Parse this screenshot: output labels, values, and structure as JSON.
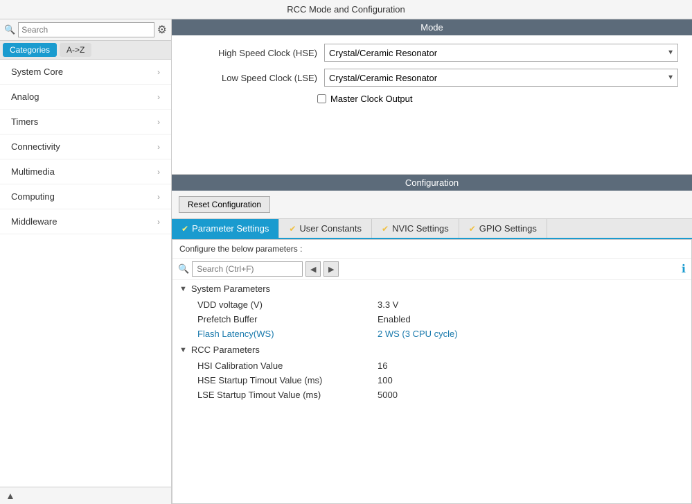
{
  "topbar": {
    "title": "RCC Mode and Configuration"
  },
  "sidebar": {
    "search_placeholder": "Search",
    "tabs": [
      {
        "label": "Categories",
        "active": true
      },
      {
        "label": "A->Z",
        "active": false
      }
    ],
    "nav_items": [
      {
        "label": "System Core"
      },
      {
        "label": "Analog"
      },
      {
        "label": "Timers"
      },
      {
        "label": "Connectivity"
      },
      {
        "label": "Multimedia"
      },
      {
        "label": "Computing"
      },
      {
        "label": "Middleware"
      }
    ],
    "bottom_icon": "▲"
  },
  "mode": {
    "header": "Mode",
    "fields": [
      {
        "label": "High Speed Clock (HSE)",
        "value": "Crystal/Ceramic Resonator"
      },
      {
        "label": "Low Speed Clock (LSE)",
        "value": "Crystal/Ceramic Resonator"
      }
    ],
    "master_clock_label": "Master Clock Output",
    "master_clock_checked": false
  },
  "config": {
    "header": "Configuration",
    "reset_button": "Reset Configuration",
    "tabs": [
      {
        "label": "Parameter Settings",
        "active": true
      },
      {
        "label": "User Constants",
        "active": false
      },
      {
        "label": "NVIC Settings",
        "active": false
      },
      {
        "label": "GPIO Settings",
        "active": false
      }
    ],
    "description": "Configure the below parameters :",
    "search_placeholder": "Search (Ctrl+F)",
    "param_groups": [
      {
        "name": "System Parameters",
        "params": [
          {
            "name": "VDD voltage (V)",
            "value": "3.3 V",
            "disabled": false
          },
          {
            "name": "Prefetch Buffer",
            "value": "Enabled",
            "disabled": false
          },
          {
            "name": "Flash Latency(WS)",
            "value": "2 WS (3 CPU cycle)",
            "disabled": true
          }
        ]
      },
      {
        "name": "RCC Parameters",
        "params": [
          {
            "name": "HSI Calibration Value",
            "value": "16",
            "disabled": false
          },
          {
            "name": "HSE Startup Timout Value (ms)",
            "value": "100",
            "disabled": false
          },
          {
            "name": "LSE Startup Timout Value (ms)",
            "value": "5000",
            "disabled": false
          }
        ]
      }
    ]
  }
}
